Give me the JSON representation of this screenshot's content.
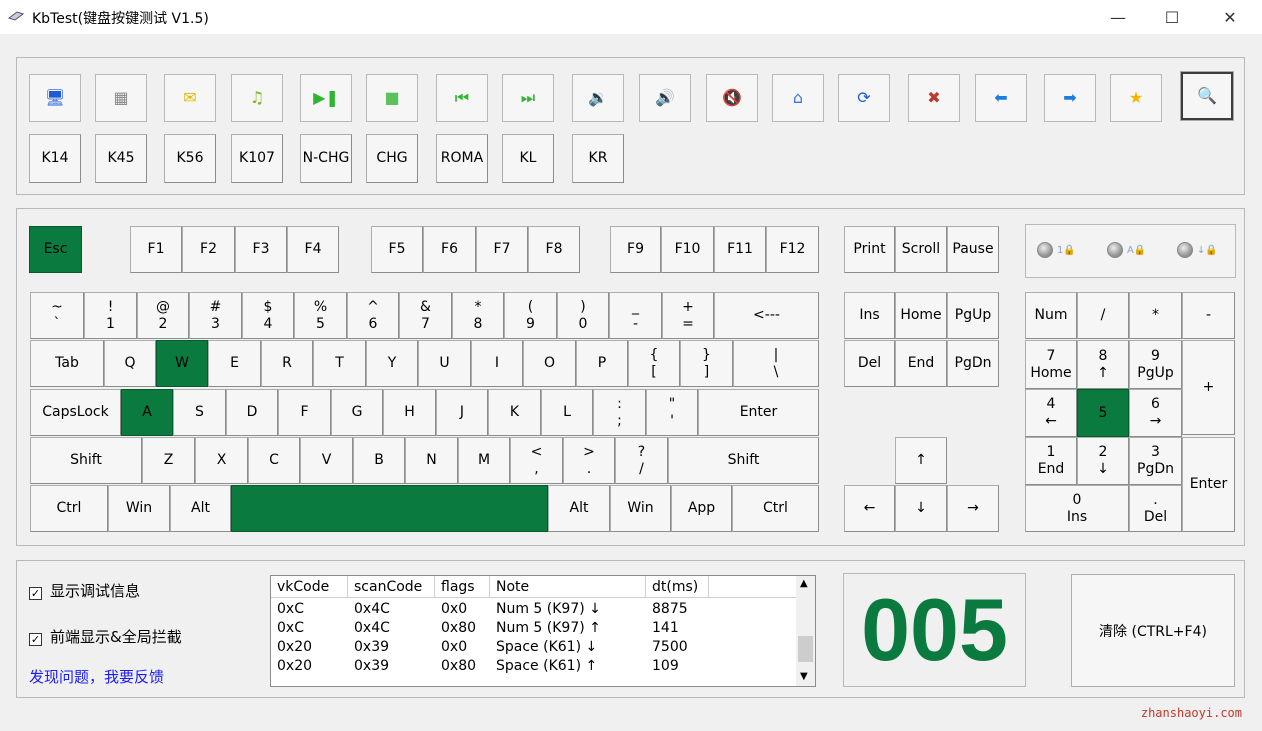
{
  "window": {
    "title": "KbTest(键盘按键测试 V1.5)",
    "minimize": "—",
    "maximize": "☐",
    "close": "✕"
  },
  "toolbar": [
    {
      "name": "my-computer-icon",
      "glyph": "🖥",
      "color": "#1e5bd8"
    },
    {
      "name": "calculator-icon",
      "glyph": "▦",
      "color": "#888"
    },
    {
      "name": "mail-icon",
      "glyph": "✉",
      "color": "#e6b800"
    },
    {
      "name": "music-icon",
      "glyph": "♫",
      "color": "#7cb518"
    },
    {
      "name": "play-pause-icon",
      "glyph": "▶❚",
      "color": "#2fb52f"
    },
    {
      "name": "stop-icon",
      "glyph": "■",
      "color": "#5cc15c"
    },
    {
      "name": "previous-track-icon",
      "glyph": "⏮",
      "color": "#2fb52f"
    },
    {
      "name": "next-track-icon",
      "glyph": "⏭",
      "color": "#2fb52f"
    },
    {
      "name": "volume-down-icon",
      "glyph": "🔉",
      "color": "#c0392b"
    },
    {
      "name": "volume-up-icon",
      "glyph": "🔊",
      "color": "#2fb52f"
    },
    {
      "name": "mute-icon",
      "glyph": "🔇",
      "color": "#c0392b"
    },
    {
      "name": "home-icon",
      "glyph": "⌂",
      "color": "#3a78d8"
    },
    {
      "name": "refresh-icon",
      "glyph": "⟳",
      "color": "#1e5bd8"
    },
    {
      "name": "stop-x-icon",
      "glyph": "✖",
      "color": "#c0392b"
    },
    {
      "name": "back-icon",
      "glyph": "⬅",
      "color": "#1e7be0"
    },
    {
      "name": "forward-icon",
      "glyph": "➡",
      "color": "#1e7be0"
    },
    {
      "name": "favorites-star-icon",
      "glyph": "★",
      "color": "#f2b600"
    },
    {
      "name": "search-magnifier-icon",
      "glyph": "🔍",
      "color": "#5a6fa0"
    }
  ],
  "special_keys": [
    "K14",
    "K45",
    "K56",
    "K107",
    "N-CHG",
    "CHG",
    "ROMA",
    "KL",
    "KR"
  ],
  "keys": {
    "esc": "Esc",
    "f1": "F1",
    "f2": "F2",
    "f3": "F3",
    "f4": "F4",
    "f5": "F5",
    "f6": "F6",
    "f7": "F7",
    "f8": "F8",
    "f9": "F9",
    "f10": "F10",
    "f11": "F11",
    "f12": "F12",
    "print": "Print",
    "scroll": "Scroll",
    "pause": "Pause",
    "tilde": [
      "~",
      "`"
    ],
    "d1": [
      "!",
      "1"
    ],
    "d2": [
      "@",
      "2"
    ],
    "d3": [
      "#",
      "3"
    ],
    "d4": [
      "$",
      "4"
    ],
    "d5": [
      "%",
      "5"
    ],
    "d6": [
      "^",
      "6"
    ],
    "d7": [
      "&",
      "7"
    ],
    "d8": [
      "*",
      "8"
    ],
    "d9": [
      "(",
      "9"
    ],
    "d0": [
      ")",
      "0"
    ],
    "minus": [
      "_",
      "-"
    ],
    "equal": [
      "+",
      "="
    ],
    "back": "<---",
    "tab": "Tab",
    "q": "Q",
    "w": "W",
    "e": "E",
    "r": "R",
    "t": "T",
    "y": "Y",
    "u": "U",
    "i": "I",
    "o": "O",
    "p": "P",
    "lbr": [
      "{",
      "["
    ],
    "rbr": [
      "}",
      "]"
    ],
    "bsl": [
      "|",
      "\\"
    ],
    "caps": "CapsLock",
    "a": "A",
    "s": "S",
    "d": "D",
    "f": "F",
    "g": "G",
    "h": "H",
    "j": "J",
    "k": "K",
    "l": "L",
    "semi": [
      ":",
      ";"
    ],
    "quote": [
      "\"",
      "'"
    ],
    "enter": "Enter",
    "lshift": "Shift",
    "z": "Z",
    "x": "X",
    "c": "C",
    "v": "V",
    "b": "B",
    "n": "N",
    "m": "M",
    "comma": [
      "<",
      ","
    ],
    "dot": [
      ">",
      "."
    ],
    "slash": [
      "?",
      "/"
    ],
    "rshift": "Shift",
    "lctrl": "Ctrl",
    "lwin": "Win",
    "lalt": "Alt",
    "space": "",
    "ralt": "Alt",
    "rwin": "Win",
    "app": "App",
    "rctrl": "Ctrl",
    "ins": "Ins",
    "home": "Home",
    "pgup": "PgUp",
    "del": "Del",
    "end": "End",
    "pgdn": "PgDn",
    "up": "↑",
    "left": "←",
    "down": "↓",
    "right": "→",
    "num": "Num",
    "ndiv": "/",
    "nmul": "*",
    "nsub": "-",
    "n7": [
      "7",
      "Home"
    ],
    "n8": [
      "8",
      "↑"
    ],
    "n9": [
      "9",
      "PgUp"
    ],
    "nadd": "+",
    "n4": [
      "4",
      "←"
    ],
    "n5": "5",
    "n6": [
      "6",
      "→"
    ],
    "n1": [
      "1",
      "End"
    ],
    "n2": [
      "2",
      "↓"
    ],
    "n3": [
      "3",
      "PgDn"
    ],
    "nenter": "Enter",
    "n0": [
      "0",
      "Ins"
    ],
    "ndot": [
      ".",
      "Del"
    ]
  },
  "pressed": [
    "esc",
    "w",
    "a",
    "space",
    "n5"
  ],
  "indicators": [
    {
      "name": "num-lock-indicator",
      "sym": "1🔒"
    },
    {
      "name": "caps-lock-indicator",
      "sym": "A🔒"
    },
    {
      "name": "scroll-lock-indicator",
      "sym": "↓🔒"
    }
  ],
  "options": {
    "debug_label": "显示调试信息",
    "front_label": "前端显示&全局拦截",
    "feedback": "发现问题，我要反馈"
  },
  "log": {
    "columns": [
      "vkCode",
      "scanCode",
      "flags",
      "Note",
      "dt(ms)"
    ],
    "rows": [
      [
        "0xC",
        "0x4C",
        "0x0",
        "Num 5 (K97) ↓",
        "8875"
      ],
      [
        "0xC",
        "0x4C",
        "0x80",
        "Num 5 (K97)  ↑",
        "141"
      ],
      [
        "0x20",
        "0x39",
        "0x0",
        "Space (K61) ↓",
        "7500"
      ],
      [
        "0x20",
        "0x39",
        "0x80",
        "Space (K61)  ↑",
        "109"
      ]
    ]
  },
  "counter": "005",
  "clear_label": "清除 (CTRL+F4)",
  "watermark": "zhanshaoyi.com",
  "colors": {
    "pressed": "#0b7a3e",
    "link": "#1a1aff"
  }
}
